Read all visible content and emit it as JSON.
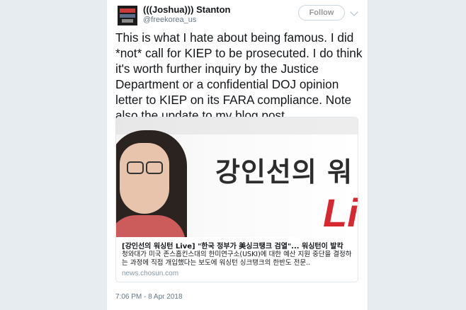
{
  "user": {
    "display_name": "(((Joshua))) Stanton",
    "handle": "@freekorea_us"
  },
  "follow_label": "Follow",
  "tweet_text": "This is what I hate about being famous. I did\n*not* call for KIEP to be prosecuted. I do think\nit's worth further inquiry by the Justice\nDepartment or a confidential DOJ opinion\nletter to KIEP on its FARA compliance. Note\nalso the update to my blog post.",
  "card": {
    "image_headline": "강인선의 워",
    "image_live": "Li",
    "title": "[강인선의 워싱턴 Live] \"한국 정부가 美싱크탱크 검열\"... 워싱턴이 발칵",
    "description": "청와대가 미국 존스홉킨스대의 한미연구소(USKI)에 대한 예산 지원 중단을 결정하는 과정에 직접 개입했다는 보도에 워싱턴 싱크탱크의 한반도 전문..",
    "domain": "news.chosun.com"
  },
  "timestamp": "7:06 PM - 8 Apr 2018"
}
